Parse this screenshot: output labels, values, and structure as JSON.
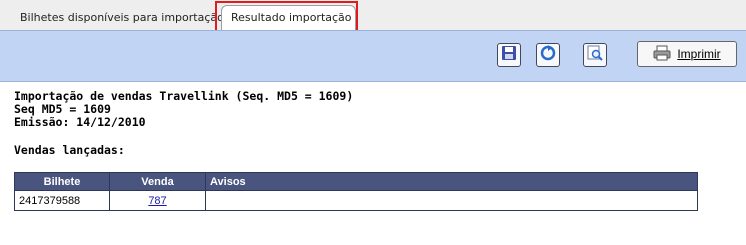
{
  "tabs": [
    {
      "label": "Bilhetes disponíveis para importação",
      "active": false
    },
    {
      "label": "Resultado importação",
      "active": true
    }
  ],
  "toolbar": {
    "icons": [
      "save-icon",
      "refresh-icon",
      "search-icon"
    ],
    "print_label": "Imprimir"
  },
  "report": {
    "line1": "Importação de vendas Travellink (Seq. MD5 = 1609)",
    "line2": "Seq MD5 = 1609",
    "line3": "Emissão: 14/12/2010",
    "section": "Vendas lançadas:"
  },
  "table": {
    "headers": [
      "Bilhete",
      "Venda",
      "Avisos"
    ],
    "rows": [
      {
        "bilhete": "2417379588",
        "venda": "787",
        "avisos": ""
      }
    ]
  },
  "colors": {
    "toolbar_bg": "#c1d4f4",
    "table_header_bg": "#49557e",
    "highlight": "#e51a1a"
  }
}
